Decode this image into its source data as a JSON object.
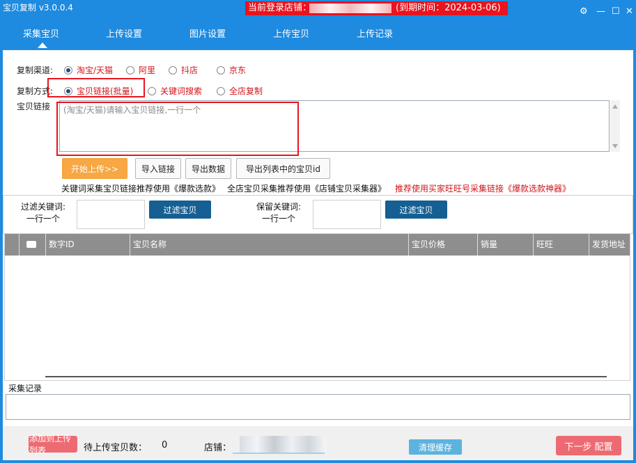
{
  "app": {
    "title": "宝贝复制 v3.0.0.4"
  },
  "login_banner": {
    "prefix": "当前登录店铺：",
    "expiry": "(到期时间：2024-03-06)"
  },
  "window_controls": {
    "settings": "⚙",
    "minimize": "—",
    "maximize": "☐",
    "close": "✕"
  },
  "tabs": [
    {
      "label": "采集宝贝",
      "active": true
    },
    {
      "label": "上传设置"
    },
    {
      "label": "图片设置"
    },
    {
      "label": "上传宝贝"
    },
    {
      "label": "上传记录"
    }
  ],
  "form": {
    "channel_label": "复制渠道:",
    "channels": [
      {
        "label": "淘宝/天猫",
        "checked": true
      },
      {
        "label": "阿里"
      },
      {
        "label": "抖店"
      },
      {
        "label": "京东"
      }
    ],
    "method_label": "复制方式:",
    "methods": [
      {
        "label": "宝贝链接(批量)",
        "checked": true
      },
      {
        "label": "关键词搜索"
      },
      {
        "label": "全店复制"
      }
    ],
    "link_label": "宝贝链接",
    "link_placeholder": "(淘宝/天猫)请输入宝贝链接,一行一个"
  },
  "actions": {
    "start_upload": "开始上传>>",
    "import_links": "导入链接",
    "export_data": "导出数据",
    "export_ids": "导出列表中的宝贝id"
  },
  "tips": {
    "keyword": "关键词采集宝贝链接推荐使用《爆款选款》",
    "shop": "全店宝贝采集推荐使用《店铺宝贝采集器》",
    "recommend": "推荐使用买家旺旺号采集链接《爆款选款神器》"
  },
  "filters": {
    "filter_label_1": "过滤关键词:",
    "filter_label_2": "一行一个",
    "filter_button": "过滤宝贝",
    "keep_label_1": "保留关键词:",
    "keep_label_2": "一行一个",
    "keep_button": "过滤宝贝"
  },
  "table": {
    "columns": [
      "",
      "",
      "数字ID",
      "宝贝名称",
      "宝贝价格",
      "销量",
      "旺旺",
      "发货地址"
    ],
    "rows": []
  },
  "log": {
    "label": "采集记录"
  },
  "footer": {
    "add_to_upload": "添加到上传列表",
    "pending_label": "待上传宝贝数：",
    "pending_count": "0",
    "shop_label": "店铺：",
    "clear_cache": "清理缓存",
    "next_step": "下一步 配置"
  },
  "colors": {
    "titlebar": "#1e8be0",
    "banner_red": "#e8141e",
    "radio_text": "#d2141a",
    "start_orange": "#f7a743",
    "filter_blue": "#155f93",
    "table_header": "#8e8e8e",
    "footer_pink": "#ee6a72",
    "cache_blue": "#5cb3de"
  }
}
